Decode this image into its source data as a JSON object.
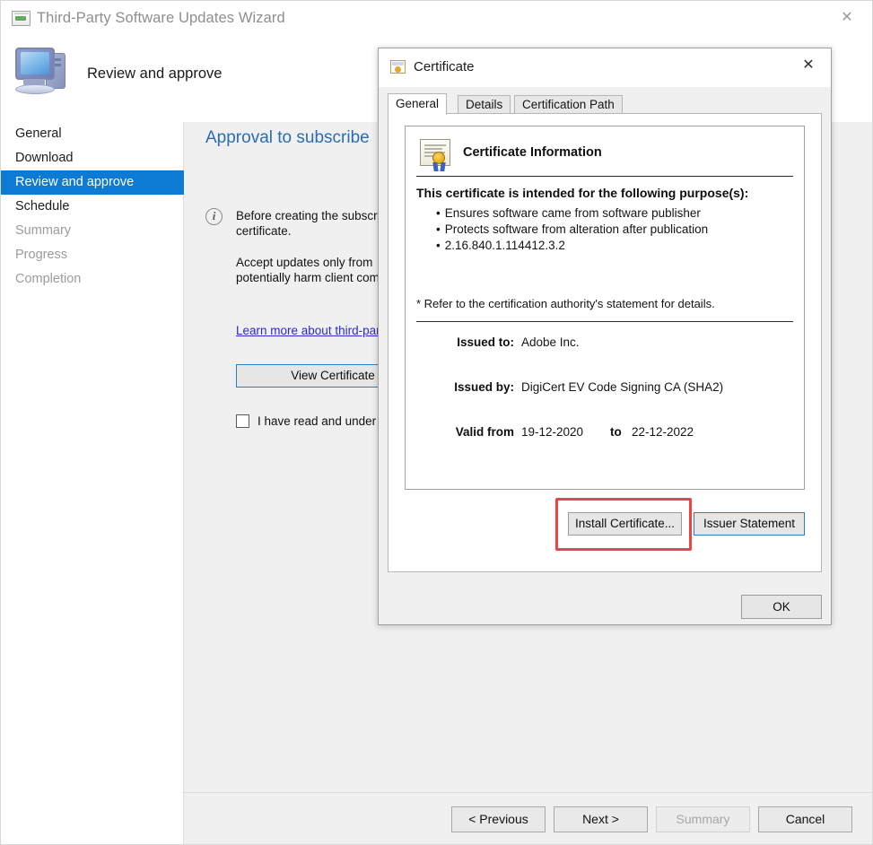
{
  "window": {
    "title": "Third-Party Software Updates Wizard",
    "icon": "wizard-window-icon",
    "close_label": "✕"
  },
  "wizard_header": {
    "icon": "computer-icon",
    "step_title": "Review and approve"
  },
  "sidebar": {
    "items": [
      {
        "label": "General",
        "state": "normal"
      },
      {
        "label": "Download",
        "state": "normal"
      },
      {
        "label": "Review and approve",
        "state": "selected"
      },
      {
        "label": "Schedule",
        "state": "normal"
      },
      {
        "label": "Summary",
        "state": "dim"
      },
      {
        "label": "Progress",
        "state": "dim"
      },
      {
        "label": "Completion",
        "state": "dim"
      }
    ],
    "selected_color": "#0d7ad4"
  },
  "content": {
    "heading": "Approval to subscribe",
    "info_icon_glyph": "i",
    "paragraph_1": "Before creating the subscr\ncertificate.",
    "paragraph_2": "Accept updates only from\npotentially harm client com",
    "learn_link": "Learn more about third-par",
    "view_certificate_button": "View Certificate",
    "consent_checkbox_label": "I have read and under",
    "consent_checked": false
  },
  "footer": {
    "buttons": [
      {
        "label": "< Previous",
        "enabled": true
      },
      {
        "label": "Next >",
        "enabled": true
      },
      {
        "label": "Summary",
        "enabled": false
      },
      {
        "label": "Cancel",
        "enabled": true
      }
    ]
  },
  "certificate_dialog": {
    "title": "Certificate",
    "icon": "certificate-icon",
    "close_label": "✕",
    "tabs": [
      {
        "label": "General",
        "active": true
      },
      {
        "label": "Details",
        "active": false
      },
      {
        "label": "Certification Path",
        "active": false
      }
    ],
    "info_heading": "Certificate Information",
    "purpose_title": "This certificate is intended for the following purpose(s):",
    "purposes": [
      "Ensures software came from software publisher",
      "Protects software from alteration after publication",
      "2.16.840.1.114412.3.2"
    ],
    "refer_note": "* Refer to the certification authority's statement for details.",
    "fields": {
      "issued_to_label": "Issued to:",
      "issued_to_value": "Adobe Inc.",
      "issued_by_label": "Issued by:",
      "issued_by_value": "DigiCert EV Code Signing CA (SHA2)",
      "valid_from_label": "Valid from",
      "valid_from_value": "19-12-2020",
      "valid_to_keyword": "to",
      "valid_to_value": "22-12-2022"
    },
    "install_button": "Install Certificate...",
    "issuer_button": "Issuer Statement",
    "ok_button": "OK",
    "highlight_color": "#ee4444",
    "focus_border_color": "#2b7dc4"
  }
}
